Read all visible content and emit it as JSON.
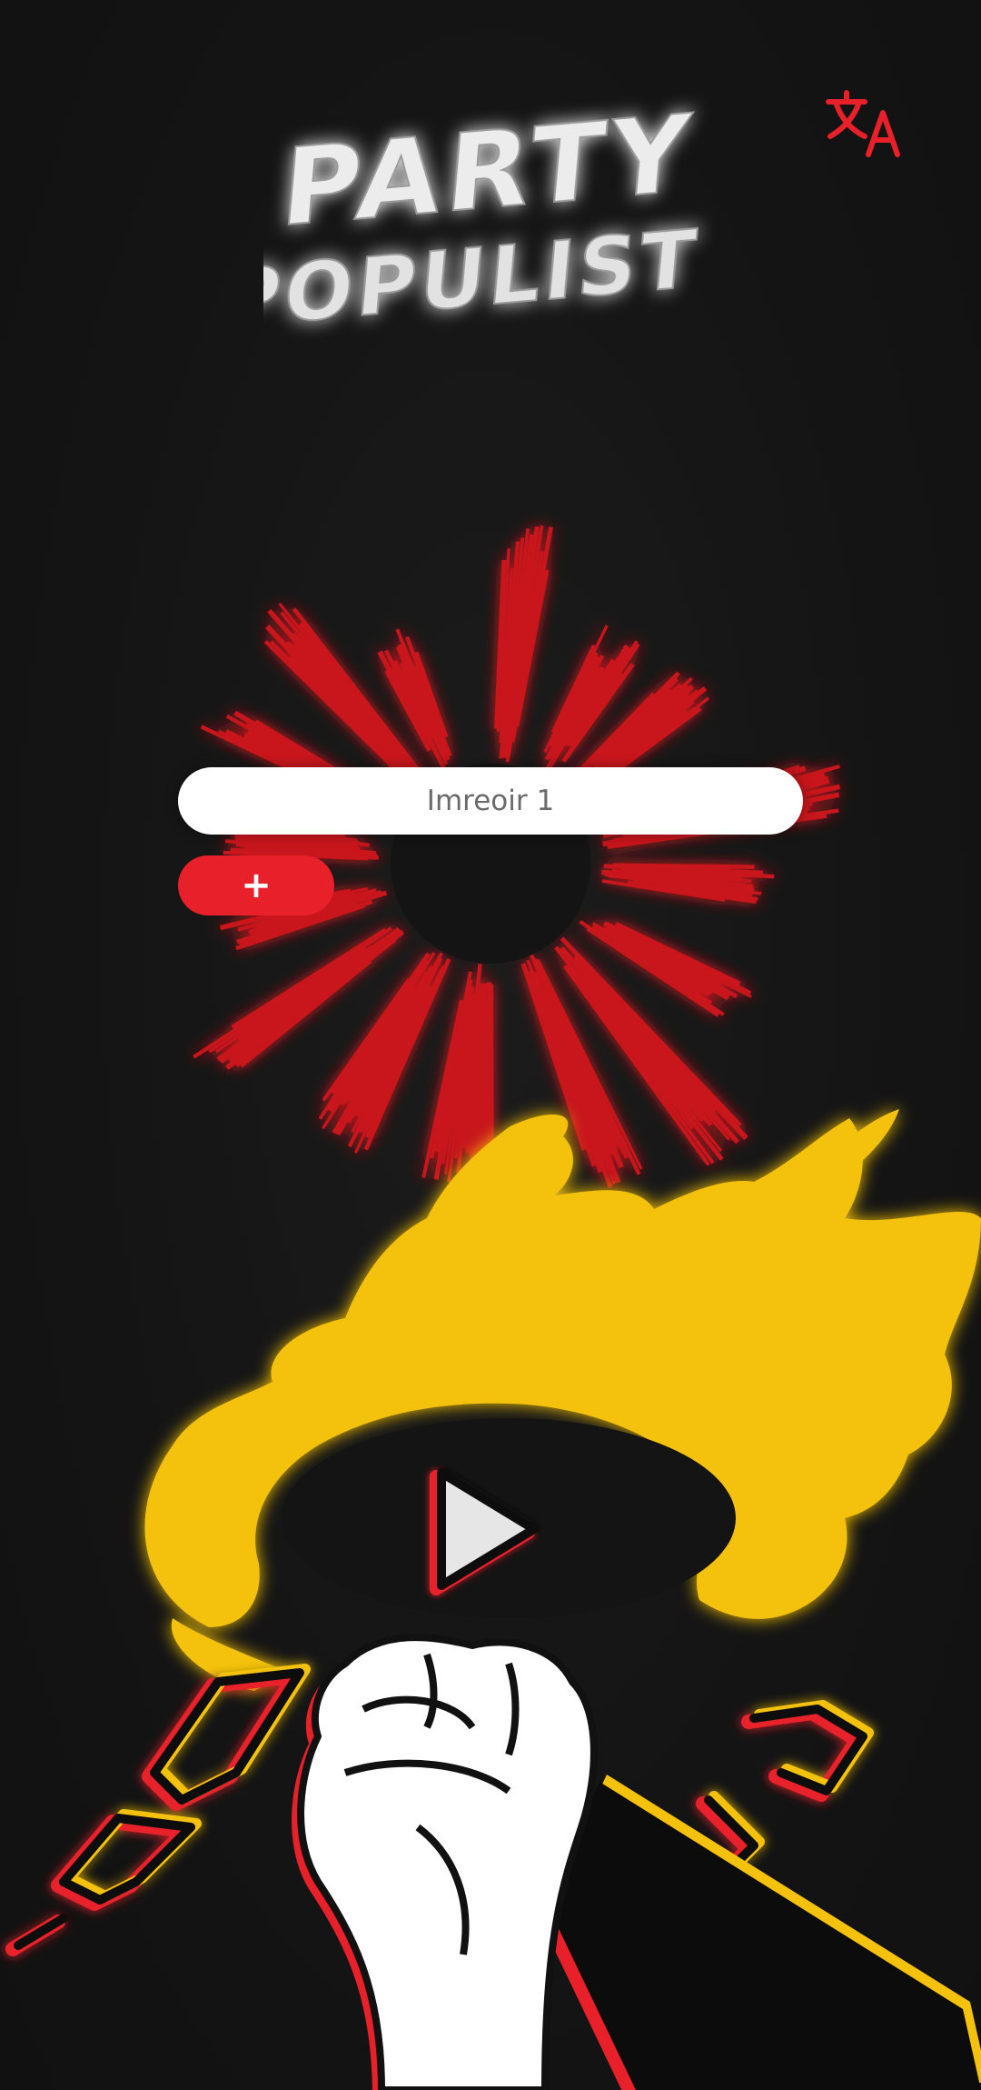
{
  "app": {
    "logo_line1": "PARTY",
    "logo_line2": "POPULIST"
  },
  "header": {
    "translate_icon": "translate-icon"
  },
  "form": {
    "player_input_value": "",
    "player_input_placeholder": "Imreoir 1",
    "add_button_label": "+"
  },
  "actions": {
    "play_icon": "play-icon"
  },
  "theme": {
    "background": "#141414",
    "accent_red": "#e8202a",
    "burst_red": "#c8141b",
    "flame_yellow": "#f4c20d",
    "input_background": "#ffffff"
  }
}
